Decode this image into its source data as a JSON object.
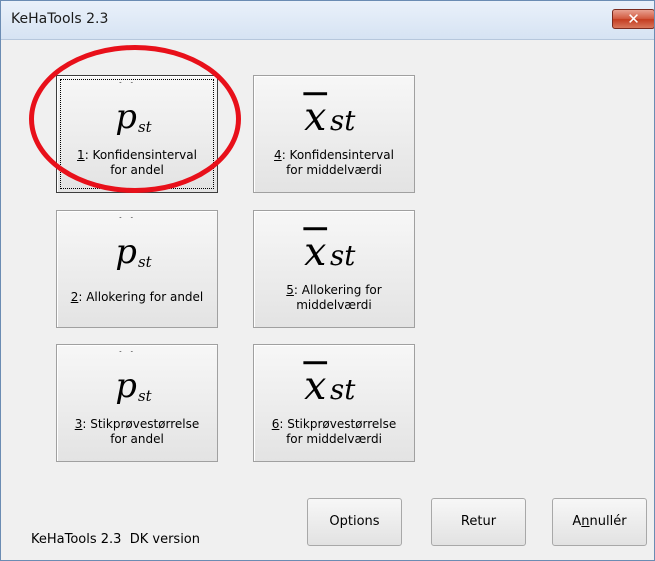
{
  "window": {
    "title": "KeHaTools 2.3",
    "close_label": "✕"
  },
  "tiles": [
    {
      "symbol": "p",
      "key": "1",
      "line1": ": Konfidensinterval",
      "line2": "for andel"
    },
    {
      "symbol": "x",
      "key": "4",
      "line1": ": Konfidensinterval",
      "line2": "for middelværdi"
    },
    {
      "symbol": "p",
      "key": "2",
      "line1": ": Allokering for andel",
      "line2": ""
    },
    {
      "symbol": "x",
      "key": "5",
      "line1": ": Allokering for",
      "line2": "middelværdi"
    },
    {
      "symbol": "p",
      "key": "3",
      "line1": ": Stikprøvestørrelse",
      "line2": "for andel"
    },
    {
      "symbol": "x",
      "key": "6",
      "line1": ": Stikprøvestørrelse",
      "line2": "for middelværdi"
    }
  ],
  "symbols": {
    "p_main": "p",
    "x_main": "x",
    "subscript": "st"
  },
  "buttons": {
    "options": "Options",
    "retur": "Retur",
    "annuller_key": "n",
    "annuller_pre": "A",
    "annuller_post": "nullér"
  },
  "footer": "KeHaTools 2.3  DK version",
  "colors": {
    "highlight_ring": "#e8101a",
    "close_button": "#c43c20"
  }
}
